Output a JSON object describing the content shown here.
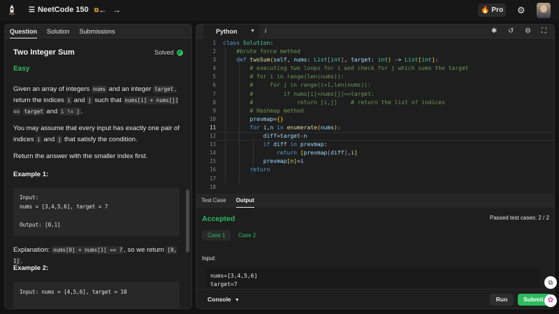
{
  "topbar": {
    "title": "NeetCode 150",
    "pro_label": "Pro"
  },
  "left": {
    "tabs": [
      "Question",
      "Solution",
      "Submissions"
    ],
    "title": "Two Integer Sum",
    "status": "Solved",
    "difficulty": "Easy",
    "p1": {
      "a": "Given an array of integers ",
      "c1": "nums",
      "b": " and an integer ",
      "c2": "target",
      "c": ", return the indices ",
      "c3": "i",
      "d": " and ",
      "c4": "j",
      "e": " such that ",
      "c5": "nums[i] + nums[j] ==",
      "c6": "target",
      "f": " and ",
      "c7": "i != j",
      "g": "."
    },
    "p2": "You may assume that every input has exactly one pair of indices",
    "p2_c1": "i",
    "p2_mid": " and ",
    "p2_c2": "j",
    "p2_end": " that satisfy the condition.",
    "p3": "Return the answer with the smaller index first.",
    "example1_head": "Example 1:",
    "example1_input_label": "Input:",
    "example1_input": "nums = [3,4,5,6], target = 7",
    "example1_output": "Output: [0,1]",
    "expl_a": "Explanation: ",
    "expl_c1": "nums[0] + nums[1] == 7",
    "expl_b": ", so we return ",
    "expl_c2": "[0, 1]",
    "expl_end": ".",
    "example2_head": "Example 2:",
    "example2_input": "Input: nums = [4,5,6], target = 10"
  },
  "editor": {
    "language": "Python",
    "line_numbers": [
      "1",
      "2",
      "3",
      "4",
      "5",
      "6",
      "7",
      "8",
      "9",
      "10",
      "11",
      "12",
      "13",
      "14",
      "15",
      "16",
      "17",
      "18"
    ],
    "current_line": 11
  },
  "output": {
    "tabs": [
      "Test Case",
      "Output"
    ],
    "result": "Accepted",
    "passed": "Passed test cases: 2 / 2",
    "cases": [
      "Case 1",
      "Case 2"
    ],
    "input_label": "Input:",
    "input_line1": "nums=[3,4,5,6]",
    "input_line2": "target=7",
    "console_label": "Console",
    "run_label": "Run",
    "submit_label": "Submit"
  },
  "colors": {
    "accent_green": "#2cbb5d",
    "background": "#121212",
    "panel": "#1e1e1e"
  },
  "icons": [
    "rocket-logo-icon",
    "list-icon",
    "external-link-icon",
    "arrow-left-icon",
    "arrow-right-icon",
    "flame-icon",
    "gear-icon",
    "bug-icon",
    "undo-icon",
    "settings-icon",
    "fullscreen-icon",
    "chevron-down-icon",
    "check-icon",
    "brain-icon",
    "translate-icon"
  ]
}
